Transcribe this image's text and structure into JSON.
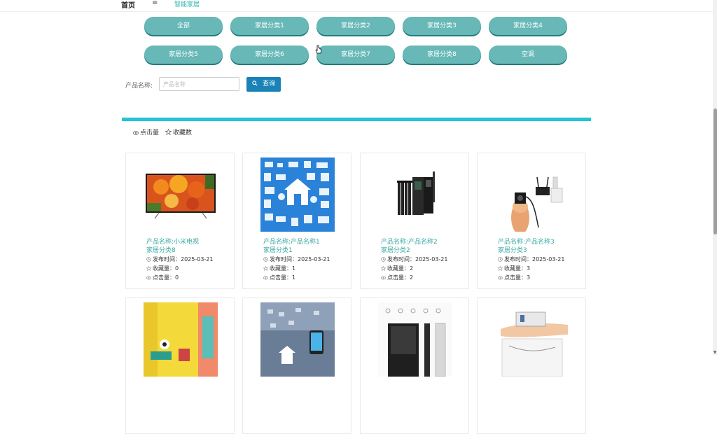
{
  "breadcrumb": {
    "home": "首页",
    "separator": "≡",
    "current": "智能家居"
  },
  "categories": [
    "全部",
    "家居分类1",
    "家居分类2",
    "家居分类3",
    "家居分类4",
    "家居分类5",
    "家居分类6",
    "家居分类7",
    "家居分类8",
    "空调"
  ],
  "search": {
    "label": "产品名称:",
    "placeholder": "产品名称",
    "value": "",
    "button": "查询"
  },
  "sort": {
    "clicks": "点击量",
    "favorites": "收藏数"
  },
  "accent_colors": {
    "category_button": "#67b8b7",
    "search_button": "#1a82b6",
    "divider": "#22c4d6",
    "product_text": "#3aa9a3"
  },
  "products": [
    {
      "name": "产品名称:小米电视",
      "category": "家居分类8",
      "publish": "发布时间：2025-03-21",
      "favorites": "收藏量：0",
      "clicks": "点击量：0"
    },
    {
      "name": "产品名称:产品名称1",
      "category": "家居分类1",
      "publish": "发布时间：2025-03-21",
      "favorites": "收藏量：1",
      "clicks": "点击量：1"
    },
    {
      "name": "产品名称:产品名称2",
      "category": "家居分类2",
      "publish": "发布时间：2025-03-21",
      "favorites": "收藏量：2",
      "clicks": "点击量：2"
    },
    {
      "name": "产品名称:产品名称3",
      "category": "家居分类3",
      "publish": "发布时间：2025-03-21",
      "favorites": "收藏量：3",
      "clicks": "点击量：3"
    }
  ]
}
